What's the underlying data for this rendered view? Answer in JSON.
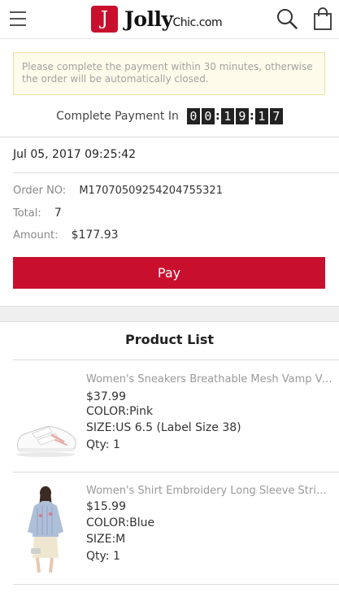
{
  "header": {
    "logo_mark": "J",
    "logo_name": "Jolly",
    "logo_suffix": "Chic.com",
    "menu_icon": "hamburger-menu-icon",
    "search_icon": "search-icon",
    "bag_icon": "shopping-bag-icon",
    "brand_color": "#c8102e"
  },
  "notice": {
    "text": "Please complete the payment within 30 minutes, otherwise the order will be automatically closed."
  },
  "countdown": {
    "label": "Complete Payment In",
    "hours": [
      "0",
      "0"
    ],
    "minutes": [
      "1",
      "9"
    ],
    "seconds": [
      "1",
      "7"
    ],
    "separator": ":"
  },
  "order": {
    "date": "Jul 05, 2017 09:25:42",
    "order_no_label": "Order NO:",
    "order_no": "M17070509254204755321",
    "total_label": "Total:",
    "total": "7",
    "amount_label": "Amount:",
    "amount": "$177.93"
  },
  "pay_button": "Pay",
  "product_list": {
    "title": "Product List",
    "items": [
      {
        "name": "Women's Sneakers Breathable Mesh Vamp Velcro Casual Sports Shoes",
        "price": "$37.99",
        "color": "COLOR:Pink",
        "size": "SIZE:US 6.5 (Label Size 38)",
        "qty": "Qty: 1",
        "image_icon": "sneaker-product-image"
      },
      {
        "name": "Women's Shirt Embroidery Long Sleeve Striped Blouse",
        "price": "$15.99",
        "color": "COLOR:Blue",
        "size": "SIZE:M",
        "qty": "Qty: 1",
        "image_icon": "shirt-model-product-image"
      }
    ]
  }
}
